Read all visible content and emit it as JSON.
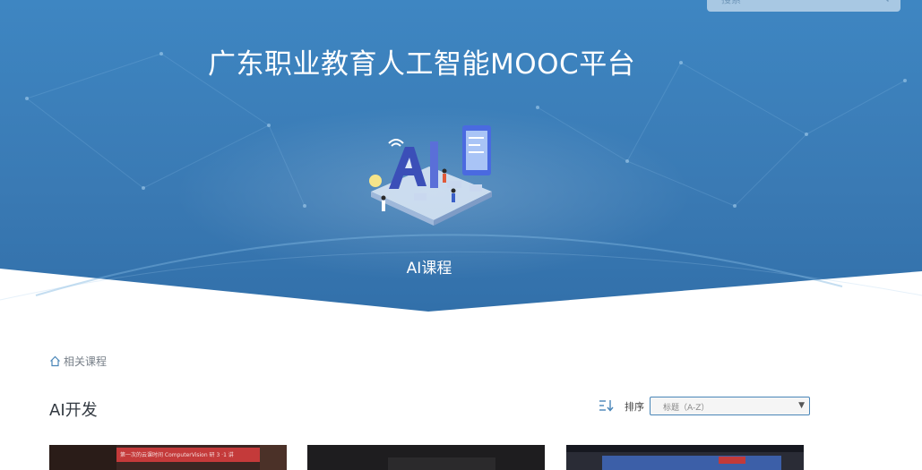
{
  "search": {
    "placeholder": "搜索"
  },
  "header": {
    "title": "广东职业教育人工智能MOOC平台",
    "subtitle": "AI课程"
  },
  "breadcrumb": {
    "label": "相关课程",
    "icon": "home-icon"
  },
  "section": {
    "title": "AI开发"
  },
  "sort": {
    "label": "排序",
    "selected": "标题（A-Z）",
    "icon": "sort-icon"
  },
  "cards": [
    {
      "banner_text": "第一次的云课时间 ComputerVision 研 3 ·1 讲"
    },
    {},
    {}
  ],
  "colors": {
    "hero_blue": "#3a7eb8",
    "accent": "#4a86b8"
  }
}
